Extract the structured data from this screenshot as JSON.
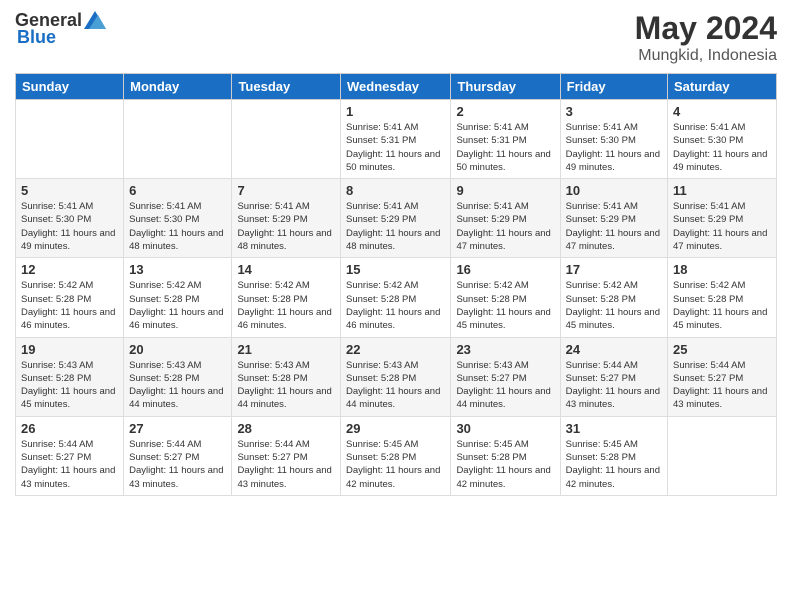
{
  "header": {
    "logo": {
      "general": "General",
      "blue": "Blue"
    },
    "title": "May 2024",
    "location": "Mungkid, Indonesia"
  },
  "weekdays": [
    "Sunday",
    "Monday",
    "Tuesday",
    "Wednesday",
    "Thursday",
    "Friday",
    "Saturday"
  ],
  "weeks": [
    [
      {
        "day": "",
        "sunrise": "",
        "sunset": "",
        "daylight": ""
      },
      {
        "day": "",
        "sunrise": "",
        "sunset": "",
        "daylight": ""
      },
      {
        "day": "",
        "sunrise": "",
        "sunset": "",
        "daylight": ""
      },
      {
        "day": "1",
        "sunrise": "Sunrise: 5:41 AM",
        "sunset": "Sunset: 5:31 PM",
        "daylight": "Daylight: 11 hours and 50 minutes."
      },
      {
        "day": "2",
        "sunrise": "Sunrise: 5:41 AM",
        "sunset": "Sunset: 5:31 PM",
        "daylight": "Daylight: 11 hours and 50 minutes."
      },
      {
        "day": "3",
        "sunrise": "Sunrise: 5:41 AM",
        "sunset": "Sunset: 5:30 PM",
        "daylight": "Daylight: 11 hours and 49 minutes."
      },
      {
        "day": "4",
        "sunrise": "Sunrise: 5:41 AM",
        "sunset": "Sunset: 5:30 PM",
        "daylight": "Daylight: 11 hours and 49 minutes."
      }
    ],
    [
      {
        "day": "5",
        "sunrise": "Sunrise: 5:41 AM",
        "sunset": "Sunset: 5:30 PM",
        "daylight": "Daylight: 11 hours and 49 minutes."
      },
      {
        "day": "6",
        "sunrise": "Sunrise: 5:41 AM",
        "sunset": "Sunset: 5:30 PM",
        "daylight": "Daylight: 11 hours and 48 minutes."
      },
      {
        "day": "7",
        "sunrise": "Sunrise: 5:41 AM",
        "sunset": "Sunset: 5:29 PM",
        "daylight": "Daylight: 11 hours and 48 minutes."
      },
      {
        "day": "8",
        "sunrise": "Sunrise: 5:41 AM",
        "sunset": "Sunset: 5:29 PM",
        "daylight": "Daylight: 11 hours and 48 minutes."
      },
      {
        "day": "9",
        "sunrise": "Sunrise: 5:41 AM",
        "sunset": "Sunset: 5:29 PM",
        "daylight": "Daylight: 11 hours and 47 minutes."
      },
      {
        "day": "10",
        "sunrise": "Sunrise: 5:41 AM",
        "sunset": "Sunset: 5:29 PM",
        "daylight": "Daylight: 11 hours and 47 minutes."
      },
      {
        "day": "11",
        "sunrise": "Sunrise: 5:41 AM",
        "sunset": "Sunset: 5:29 PM",
        "daylight": "Daylight: 11 hours and 47 minutes."
      }
    ],
    [
      {
        "day": "12",
        "sunrise": "Sunrise: 5:42 AM",
        "sunset": "Sunset: 5:28 PM",
        "daylight": "Daylight: 11 hours and 46 minutes."
      },
      {
        "day": "13",
        "sunrise": "Sunrise: 5:42 AM",
        "sunset": "Sunset: 5:28 PM",
        "daylight": "Daylight: 11 hours and 46 minutes."
      },
      {
        "day": "14",
        "sunrise": "Sunrise: 5:42 AM",
        "sunset": "Sunset: 5:28 PM",
        "daylight": "Daylight: 11 hours and 46 minutes."
      },
      {
        "day": "15",
        "sunrise": "Sunrise: 5:42 AM",
        "sunset": "Sunset: 5:28 PM",
        "daylight": "Daylight: 11 hours and 46 minutes."
      },
      {
        "day": "16",
        "sunrise": "Sunrise: 5:42 AM",
        "sunset": "Sunset: 5:28 PM",
        "daylight": "Daylight: 11 hours and 45 minutes."
      },
      {
        "day": "17",
        "sunrise": "Sunrise: 5:42 AM",
        "sunset": "Sunset: 5:28 PM",
        "daylight": "Daylight: 11 hours and 45 minutes."
      },
      {
        "day": "18",
        "sunrise": "Sunrise: 5:42 AM",
        "sunset": "Sunset: 5:28 PM",
        "daylight": "Daylight: 11 hours and 45 minutes."
      }
    ],
    [
      {
        "day": "19",
        "sunrise": "Sunrise: 5:43 AM",
        "sunset": "Sunset: 5:28 PM",
        "daylight": "Daylight: 11 hours and 45 minutes."
      },
      {
        "day": "20",
        "sunrise": "Sunrise: 5:43 AM",
        "sunset": "Sunset: 5:28 PM",
        "daylight": "Daylight: 11 hours and 44 minutes."
      },
      {
        "day": "21",
        "sunrise": "Sunrise: 5:43 AM",
        "sunset": "Sunset: 5:28 PM",
        "daylight": "Daylight: 11 hours and 44 minutes."
      },
      {
        "day": "22",
        "sunrise": "Sunrise: 5:43 AM",
        "sunset": "Sunset: 5:28 PM",
        "daylight": "Daylight: 11 hours and 44 minutes."
      },
      {
        "day": "23",
        "sunrise": "Sunrise: 5:43 AM",
        "sunset": "Sunset: 5:27 PM",
        "daylight": "Daylight: 11 hours and 44 minutes."
      },
      {
        "day": "24",
        "sunrise": "Sunrise: 5:44 AM",
        "sunset": "Sunset: 5:27 PM",
        "daylight": "Daylight: 11 hours and 43 minutes."
      },
      {
        "day": "25",
        "sunrise": "Sunrise: 5:44 AM",
        "sunset": "Sunset: 5:27 PM",
        "daylight": "Daylight: 11 hours and 43 minutes."
      }
    ],
    [
      {
        "day": "26",
        "sunrise": "Sunrise: 5:44 AM",
        "sunset": "Sunset: 5:27 PM",
        "daylight": "Daylight: 11 hours and 43 minutes."
      },
      {
        "day": "27",
        "sunrise": "Sunrise: 5:44 AM",
        "sunset": "Sunset: 5:27 PM",
        "daylight": "Daylight: 11 hours and 43 minutes."
      },
      {
        "day": "28",
        "sunrise": "Sunrise: 5:44 AM",
        "sunset": "Sunset: 5:27 PM",
        "daylight": "Daylight: 11 hours and 43 minutes."
      },
      {
        "day": "29",
        "sunrise": "Sunrise: 5:45 AM",
        "sunset": "Sunset: 5:28 PM",
        "daylight": "Daylight: 11 hours and 42 minutes."
      },
      {
        "day": "30",
        "sunrise": "Sunrise: 5:45 AM",
        "sunset": "Sunset: 5:28 PM",
        "daylight": "Daylight: 11 hours and 42 minutes."
      },
      {
        "day": "31",
        "sunrise": "Sunrise: 5:45 AM",
        "sunset": "Sunset: 5:28 PM",
        "daylight": "Daylight: 11 hours and 42 minutes."
      },
      {
        "day": "",
        "sunrise": "",
        "sunset": "",
        "daylight": ""
      }
    ]
  ]
}
